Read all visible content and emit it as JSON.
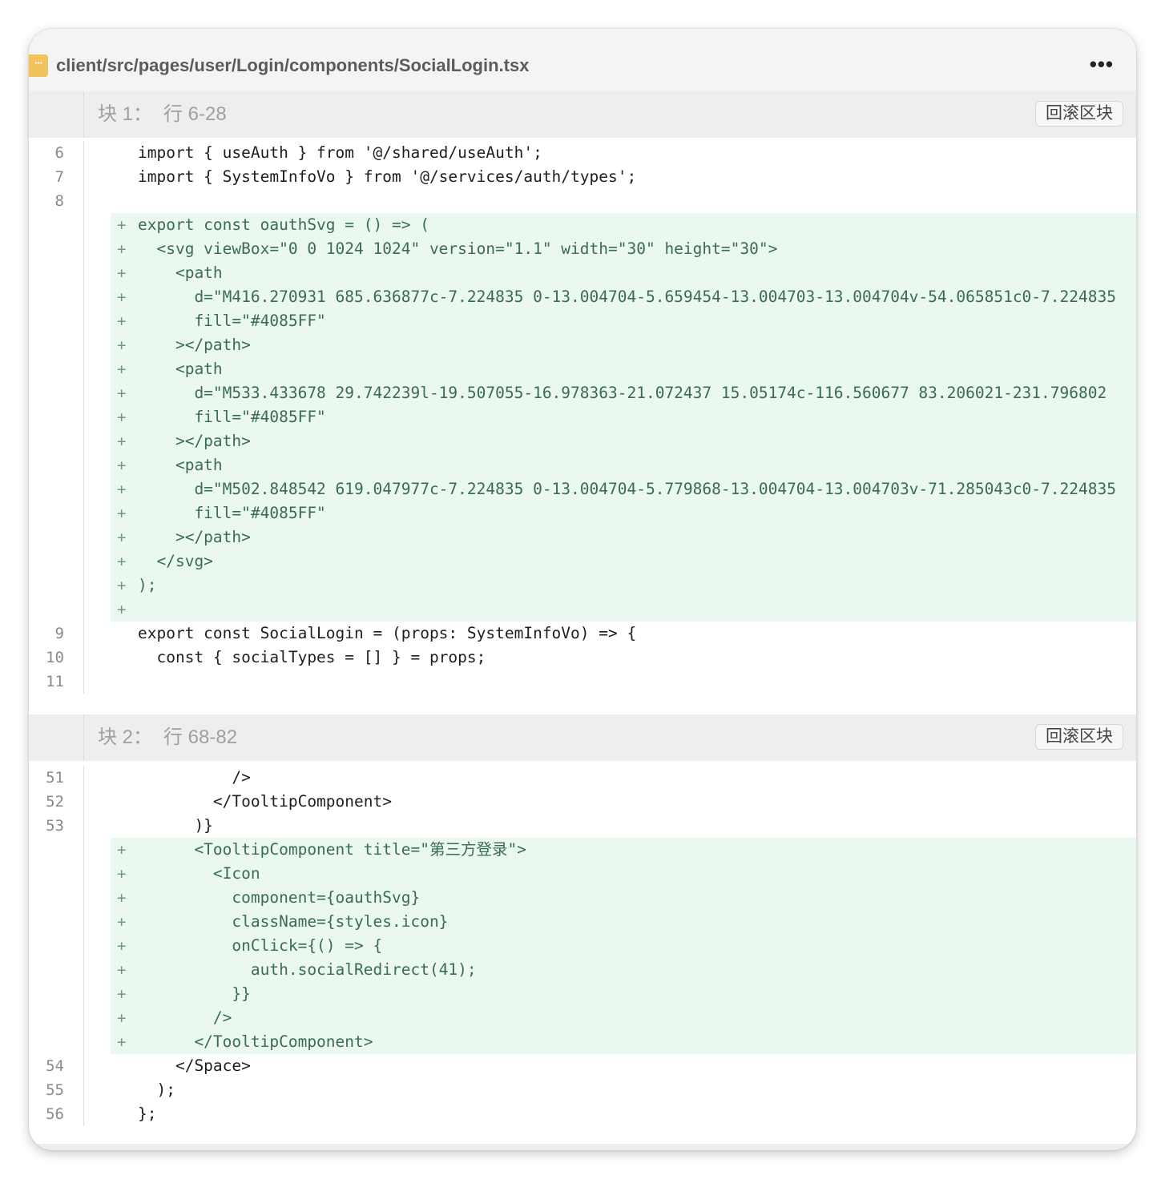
{
  "file": {
    "icon_glyph": "···",
    "path": "client/src/pages/user/Login/components/SocialLogin.tsx",
    "more_glyph": "•••"
  },
  "hunks": [
    {
      "label_block": "块 1：",
      "label_range": "行 6-28",
      "revert_label": "回滚区块",
      "lines": [
        {
          "num": "6",
          "add": false,
          "text": "import { useAuth } from '@/shared/useAuth';"
        },
        {
          "num": "7",
          "add": false,
          "text": "import { SystemInfoVo } from '@/services/auth/types';"
        },
        {
          "num": "8",
          "add": false,
          "text": ""
        },
        {
          "num": "",
          "add": true,
          "marker": "+",
          "text": "export const oauthSvg = () => ("
        },
        {
          "num": "",
          "add": true,
          "marker": "+",
          "text": "  <svg viewBox=\"0 0 1024 1024\" version=\"1.1\" width=\"30\" height=\"30\">"
        },
        {
          "num": "",
          "add": true,
          "marker": "+",
          "text": "    <path"
        },
        {
          "num": "",
          "add": true,
          "marker": "+",
          "text": "      d=\"M416.270931 685.636877c-7.224835 0-13.004704-5.659454-13.004703-13.004704v-54.065851c0-7.224835"
        },
        {
          "num": "",
          "add": true,
          "marker": "+",
          "text": "      fill=\"#4085FF\""
        },
        {
          "num": "",
          "add": true,
          "marker": "+",
          "text": "    ></path>"
        },
        {
          "num": "",
          "add": true,
          "marker": "+",
          "text": "    <path"
        },
        {
          "num": "",
          "add": true,
          "marker": "+",
          "text": "      d=\"M533.433678 29.742239l-19.507055-16.978363-21.072437 15.05174c-116.560677 83.206021-231.796802"
        },
        {
          "num": "",
          "add": true,
          "marker": "+",
          "text": "      fill=\"#4085FF\""
        },
        {
          "num": "",
          "add": true,
          "marker": "+",
          "text": "    ></path>"
        },
        {
          "num": "",
          "add": true,
          "marker": "+",
          "text": "    <path"
        },
        {
          "num": "",
          "add": true,
          "marker": "+",
          "text": "      d=\"M502.848542 619.047977c-7.224835 0-13.004704-5.779868-13.004704-13.004703v-71.285043c0-7.224835"
        },
        {
          "num": "",
          "add": true,
          "marker": "+",
          "text": "      fill=\"#4085FF\""
        },
        {
          "num": "",
          "add": true,
          "marker": "+",
          "text": "    ></path>"
        },
        {
          "num": "",
          "add": true,
          "marker": "+",
          "text": "  </svg>"
        },
        {
          "num": "",
          "add": true,
          "marker": "+",
          "text": ");"
        },
        {
          "num": "",
          "add": true,
          "marker": "+",
          "text": ""
        },
        {
          "num": "9",
          "add": false,
          "text": "export const SocialLogin = (props: SystemInfoVo) => {"
        },
        {
          "num": "10",
          "add": false,
          "text": "  const { socialTypes = [] } = props;"
        },
        {
          "num": "11",
          "add": false,
          "text": ""
        }
      ]
    },
    {
      "label_block": "块 2：",
      "label_range": "行 68-82",
      "revert_label": "回滚区块",
      "lines": [
        {
          "num": "51",
          "add": false,
          "text": "          />"
        },
        {
          "num": "52",
          "add": false,
          "text": "        </TooltipComponent>"
        },
        {
          "num": "53",
          "add": false,
          "text": "      )}"
        },
        {
          "num": "",
          "add": true,
          "marker": "+",
          "text": "      <TooltipComponent title=\"第三方登录\">"
        },
        {
          "num": "",
          "add": true,
          "marker": "+",
          "text": "        <Icon"
        },
        {
          "num": "",
          "add": true,
          "marker": "+",
          "text": "          component={oauthSvg}"
        },
        {
          "num": "",
          "add": true,
          "marker": "+",
          "text": "          className={styles.icon}"
        },
        {
          "num": "",
          "add": true,
          "marker": "+",
          "text": "          onClick={() => {"
        },
        {
          "num": "",
          "add": true,
          "marker": "+",
          "text": "            auth.socialRedirect(41);"
        },
        {
          "num": "",
          "add": true,
          "marker": "+",
          "text": "          }}"
        },
        {
          "num": "",
          "add": true,
          "marker": "+",
          "text": "        />"
        },
        {
          "num": "",
          "add": true,
          "marker": "+",
          "text": "      </TooltipComponent>"
        },
        {
          "num": "54",
          "add": false,
          "text": "    </Space>"
        },
        {
          "num": "55",
          "add": false,
          "text": "  );"
        },
        {
          "num": "56",
          "add": false,
          "text": "};"
        }
      ]
    }
  ]
}
